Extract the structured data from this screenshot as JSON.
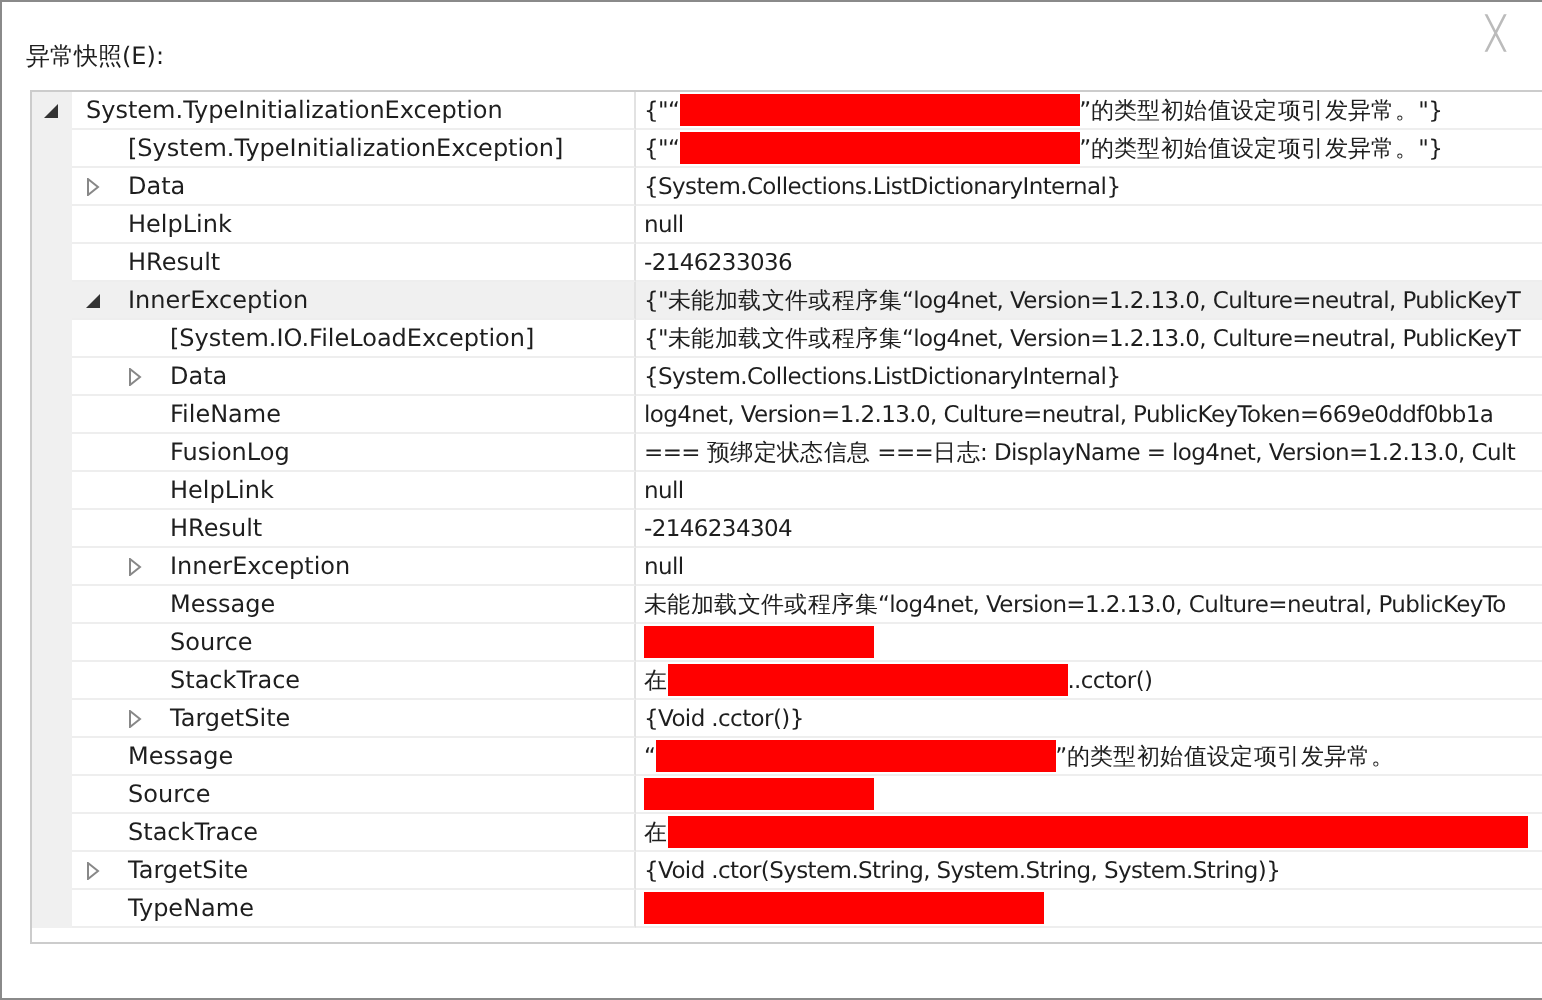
{
  "dialog": {
    "title": "异常快照(E):",
    "close": "╳"
  },
  "rows": [
    {
      "name": "System.TypeInitializationException",
      "before": "{\"“",
      "redaction": {
        "kind": "long"
      },
      "after": "”的类型初始值设定项引发异常。\"}",
      "expanded": true,
      "selected": false,
      "children": [
        {
          "name": "[System.TypeInitializationException]",
          "before": "{\"“",
          "redaction": {
            "kind": "long"
          },
          "after": "”的类型初始值设定项引发异常。\"}",
          "selected": false
        },
        {
          "name": "Data",
          "before": "{System.Collections.ListDictionaryInternal}",
          "expanded": false,
          "selected": false
        },
        {
          "name": "HelpLink",
          "before": "null",
          "selected": false
        },
        {
          "name": "HResult",
          "before": "-2146233036",
          "selected": false
        },
        {
          "name": "InnerException",
          "before": "{\"未能加载文件或程序集“log4net, Version=1.2.13.0, Culture=neutral, PublicKeyT",
          "expanded": true,
          "selected": true,
          "children": [
            {
              "name": "[System.IO.FileLoadException]",
              "before": "{\"未能加载文件或程序集“log4net, Version=1.2.13.0, Culture=neutral, PublicKeyT",
              "selected": false
            },
            {
              "name": "Data",
              "before": "{System.Collections.ListDictionaryInternal}",
              "expanded": false,
              "selected": false
            },
            {
              "name": "FileName",
              "before": "log4net, Version=1.2.13.0, Culture=neutral, PublicKeyToken=669e0ddf0bb1a",
              "selected": false
            },
            {
              "name": "FusionLog",
              "before": "=== 预绑定状态信息 ===日志: DisplayName = log4net, Version=1.2.13.0, Cult",
              "selected": false
            },
            {
              "name": "HelpLink",
              "before": "null",
              "selected": false
            },
            {
              "name": "HResult",
              "before": "-2146234304",
              "selected": false
            },
            {
              "name": "InnerException",
              "before": "null",
              "expanded": false,
              "selected": false
            },
            {
              "name": "Message",
              "before": "未能加载文件或程序集“log4net, Version=1.2.13.0, Culture=neutral, PublicKeyTo",
              "selected": false
            },
            {
              "name": "Source",
              "redaction": {
                "kind": "short"
              },
              "selected": false
            },
            {
              "name": "StackTrace",
              "before": "在",
              "redaction": {
                "kind": "long"
              },
              "after": "..cctor()",
              "selected": false
            },
            {
              "name": "TargetSite",
              "before": "{Void .cctor()}",
              "expanded": false,
              "selected": false
            }
          ]
        },
        {
          "name": "Message",
          "before": "“",
          "redaction": {
            "kind": "long"
          },
          "after": "”的类型初始值设定项引发异常。",
          "selected": false
        },
        {
          "name": "Source",
          "redaction": {
            "kind": "short"
          },
          "selected": false
        },
        {
          "name": "StackTrace",
          "before": "在",
          "redaction": {
            "kind": "full"
          },
          "selected": false
        },
        {
          "name": "TargetSite",
          "before": "{Void .ctor(System.String, System.String, System.String)}",
          "expanded": false,
          "selected": false
        },
        {
          "name": "TypeName",
          "redaction": {
            "kind": "long"
          },
          "selected": false
        }
      ]
    }
  ]
}
